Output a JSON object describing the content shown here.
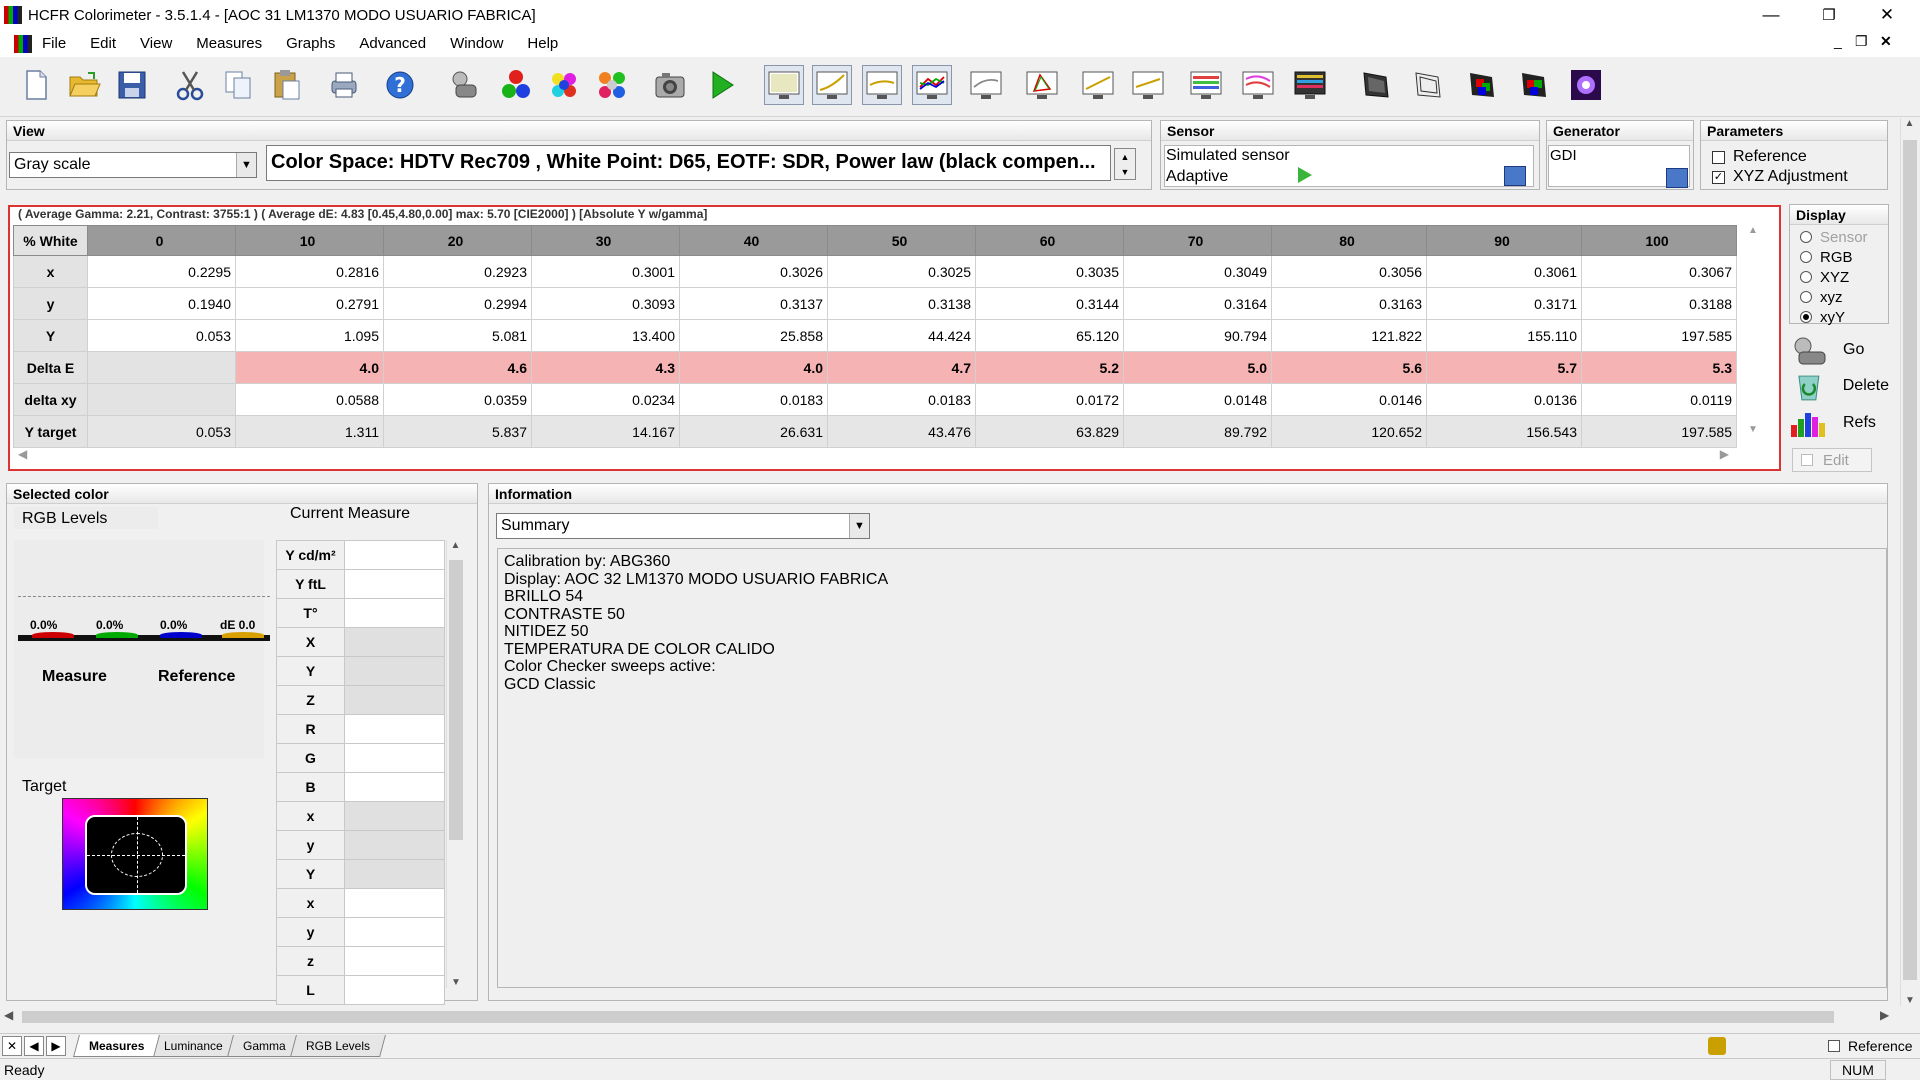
{
  "window": {
    "title": "HCFR Colorimeter - 3.5.1.4 - [AOC 31 LM1370 MODO USUARIO FABRICA]",
    "minimize": "—",
    "restore": "❐",
    "close": "✕"
  },
  "menu": {
    "items": [
      "File",
      "Edit",
      "View",
      "Measures",
      "Graphs",
      "Advanced",
      "Window",
      "Help"
    ],
    "mdi_minimize": "_",
    "mdi_restore": "❐",
    "mdi_close": "✕"
  },
  "view": {
    "label": "View",
    "selected": "Gray scale",
    "colorspace_text": "Color Space: HDTV Rec709 , White Point: D65, EOTF:  SDR, Power law (black compen..."
  },
  "sensor": {
    "label": "Sensor",
    "name": "Simulated sensor",
    "mode": "Adaptive"
  },
  "generator": {
    "label": "Generator",
    "name": "GDI"
  },
  "parameters": {
    "label": "Parameters",
    "reference_label": "Reference",
    "reference_checked": false,
    "xyz_label": "XYZ Adjustment",
    "xyz_checked": true
  },
  "summary_line": "( Average Gamma: 2.21, Contrast: 3755:1 ) ( Average dE: 4.83 [0.45,4.80,0.00] max: 5.70 [CIE2000] ) [Absolute Y w/gamma]",
  "measures_table": {
    "corner": "% White",
    "columns": [
      "0",
      "10",
      "20",
      "30",
      "40",
      "50",
      "60",
      "70",
      "80",
      "90",
      "100"
    ],
    "rows": [
      {
        "label": "x",
        "values": [
          "0.2295",
          "0.2816",
          "0.2923",
          "0.3001",
          "0.3026",
          "0.3025",
          "0.3035",
          "0.3049",
          "0.3056",
          "0.3061",
          "0.3067"
        ]
      },
      {
        "label": "y",
        "values": [
          "0.1940",
          "0.2791",
          "0.2994",
          "0.3093",
          "0.3137",
          "0.3138",
          "0.3144",
          "0.3164",
          "0.3163",
          "0.3171",
          "0.3188"
        ]
      },
      {
        "label": "Y",
        "values": [
          "0.053",
          "1.095",
          "5.081",
          "13.400",
          "25.858",
          "44.424",
          "65.120",
          "90.794",
          "121.822",
          "155.110",
          "197.585"
        ]
      },
      {
        "label": "Delta E",
        "values": [
          "",
          "4.0",
          "4.6",
          "4.3",
          "4.0",
          "4.7",
          "5.2",
          "5.0",
          "5.6",
          "5.7",
          "5.3"
        ]
      },
      {
        "label": "delta xy",
        "values": [
          "",
          "0.0588",
          "0.0359",
          "0.0234",
          "0.0183",
          "0.0183",
          "0.0172",
          "0.0148",
          "0.0146",
          "0.0136",
          "0.0119"
        ]
      },
      {
        "label": "Y target",
        "values": [
          "0.053",
          "1.311",
          "5.837",
          "14.167",
          "26.631",
          "43.476",
          "63.829",
          "89.792",
          "120.652",
          "156.543",
          "197.585"
        ]
      }
    ]
  },
  "display": {
    "label": "Display",
    "options": [
      "Sensor",
      "RGB",
      "XYZ",
      "xyz",
      "xyY"
    ],
    "selected": "xyY"
  },
  "side_buttons": {
    "go": "Go",
    "delete": "Delete",
    "refs": "Refs",
    "edit": "Edit"
  },
  "selected_color": {
    "label": "Selected color",
    "rgb_levels": "RGB Levels",
    "current_measure": "Current Measure",
    "bars": [
      "0.0%",
      "0.0%",
      "0.0%",
      "dE 0.0"
    ],
    "measure_label": "Measure",
    "reference_label": "Reference",
    "target_label": "Target",
    "measure_rows": [
      "Y cd/m²",
      "Y ftL",
      "T°",
      "X",
      "Y",
      "Z",
      "R",
      "G",
      "B",
      "x",
      "y",
      "Y",
      "x",
      "y",
      "z",
      "L"
    ]
  },
  "information": {
    "label": "Information",
    "selected": "Summary",
    "text": "Calibration by: ABG360\nDisplay: AOC 32 LM1370 MODO USUARIO FABRICA\nBRILLO 54\nCONTRASTE 50\nNITIDEZ 50\nTEMPERATURA DE COLOR CALIDO\nColor Checker sweeps active:\nGCD Classic"
  },
  "tabs": {
    "items": [
      "Measures",
      "Luminance",
      "Gamma",
      "RGB Levels"
    ],
    "active": "Measures",
    "reference_label": "Reference"
  },
  "status": {
    "left": "Ready",
    "num": "NUM"
  },
  "colors": {
    "delta_e_bg": "#f6b3b3",
    "grid_border": "#dd3333",
    "header_bg": "#9a9a9a"
  }
}
